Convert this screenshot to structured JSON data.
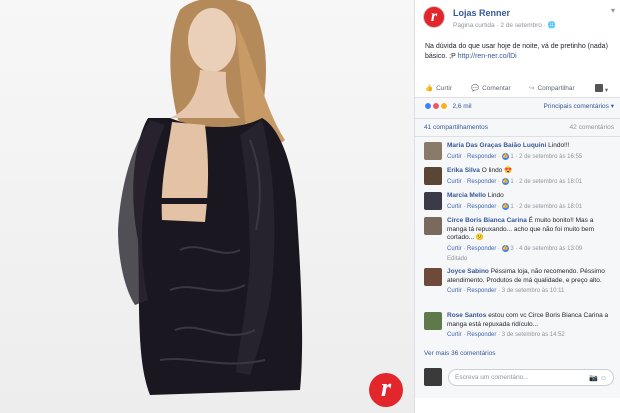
{
  "page": {
    "name": "Lojas Renner",
    "sub": "Página curtida · 2 de setembro · 🌐",
    "avatar_letter": "r",
    "menu": "▾"
  },
  "post": {
    "text": "Na dúvida do que usar hoje de noite, vá de pretinho (nada) básico. ;P ",
    "link": "http://ren-ner.co/lDi"
  },
  "actions": {
    "like": "Curtir",
    "comment": "Comentar",
    "share": "Compartilhar"
  },
  "stats": {
    "reactions": "2,6 mil",
    "sort": "Principais comentários ▾",
    "shares": "41 compartilhamentos",
    "comments": "42 comentários"
  },
  "comments": [
    {
      "name": "Maria Das Graças Baião Luquini",
      "text": "Lindo!!!",
      "like": "Curtir",
      "reply": "Responder",
      "count": "1",
      "time": "2 de setembro às 16:55",
      "avatar_color": "#8a7a6a"
    },
    {
      "name": "Erika Silva",
      "text": "O lindo 😍",
      "like": "Curtir",
      "reply": "Responder",
      "count": "1",
      "time": "2 de setembro às 18:01",
      "avatar_color": "#5b4636"
    },
    {
      "name": "Marcia Mello",
      "text": "Lindo",
      "like": "Curtir",
      "reply": "Responder",
      "count": "1",
      "time": "2 de setembro às 18:01",
      "avatar_color": "#3b3b48"
    },
    {
      "name": "Circe Boris Bianca Carina",
      "text": "É muito bonito!! Mas a manga tá repuxando... acho que não foi muito bem cortado... 😕",
      "like": "Curtir",
      "reply": "Responder",
      "count": "3",
      "time": "4 de setembro às 13:09",
      "edited": "Editado",
      "avatar_color": "#7a6a5e"
    },
    {
      "name": "Joyce Sabino",
      "text": "Péssima loja, não recomendo. Péssimo atendimento. Produtos de má qualidade, e preço alto.",
      "like": "Curtir",
      "reply": "Responder",
      "count": "",
      "time": "3 de setembro às 10:11",
      "avatar_color": "#6e4a3a"
    },
    {
      "name": "Rose Santos",
      "text": "estou com vc Circe Boris Bianca Carina a manga está repuxada ridículo...",
      "like": "Curtir",
      "reply": "Responder",
      "count": "",
      "time": "3 de setembro às 14:52",
      "avatar_color": "#5f7a4a"
    }
  ],
  "more_comments": "Ver mais 36 comentários",
  "write": {
    "placeholder": "Escreva um comentário..."
  },
  "badge_letter": "r"
}
